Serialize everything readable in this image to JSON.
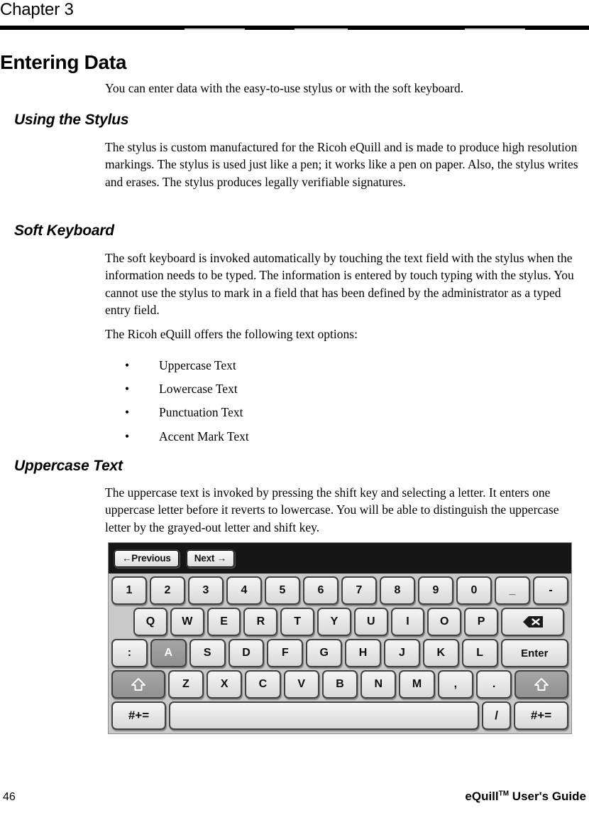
{
  "header": {
    "chapter": "Chapter 3"
  },
  "sections": {
    "entering_data": {
      "heading": "Entering Data",
      "paragraph": "You can enter data with the easy-to-use stylus or with the soft keyboard."
    },
    "using_the_stylus": {
      "heading": "Using the Stylus",
      "paragraph": "The stylus is custom manufactured for the Ricoh eQuill and is made to produce high resolution markings. The stylus is used just like a pen; it works like a pen on paper. Also, the stylus writes and erases. The stylus produces legally verifiable signatures."
    },
    "soft_keyboard": {
      "heading": "Soft Keyboard",
      "paragraph1": "The soft keyboard is invoked automatically by touching the text field with the stylus when the information needs to be typed. The information is entered by touch typing with the stylus. You cannot use the stylus to mark in a field that has been defined by the administrator as a typed entry field.",
      "paragraph2": "The Ricoh eQuill offers the following text options:",
      "bullet_marker": "•",
      "options": [
        "Uppercase Text",
        "Lowercase Text",
        "Punctuation Text",
        "Accent Mark Text"
      ]
    },
    "uppercase_text": {
      "heading": "Uppercase Text",
      "paragraph": "The uppercase text is invoked by pressing the shift key and selecting a letter. It enters one uppercase letter before it reverts to lowercase. You will be able to distinguish the uppercase letter by the grayed-out letter and shift key."
    }
  },
  "keyboard": {
    "toolbar": {
      "previous_label": "←Previous",
      "next_label": "Next →"
    },
    "row_numbers": [
      "1",
      "2",
      "3",
      "4",
      "5",
      "6",
      "7",
      "8",
      "9",
      "0",
      "_",
      "-"
    ],
    "row_qwerty": [
      "Q",
      "W",
      "E",
      "R",
      "T",
      "Y",
      "U",
      "I",
      "O",
      "P"
    ],
    "backspace_label": "",
    "row_home": [
      ":",
      "A",
      "S",
      "D",
      "F",
      "G",
      "H",
      "J",
      "K",
      "L"
    ],
    "enter_label": "Enter",
    "row_bottom": [
      "Z",
      "X",
      "C",
      "V",
      "B",
      "N",
      "M",
      ",",
      "."
    ],
    "shift_label": "",
    "row_space": {
      "symbol_left": "#+=",
      "space_label": "",
      "slash_label": "/",
      "symbol_right": "#+="
    },
    "highlighted_keys": [
      "A",
      "shift-left",
      "shift-right"
    ],
    "colors": {
      "toolbar_background": "#161616",
      "key_face": "#e7e7e7",
      "key_highlight": "#9a9a9a",
      "keyboard_background": "#c9c9c9"
    }
  },
  "footer": {
    "page_number": "46",
    "guide_name": "eQuill",
    "guide_tm": "TM",
    "guide_suffix": " User's Guide"
  }
}
